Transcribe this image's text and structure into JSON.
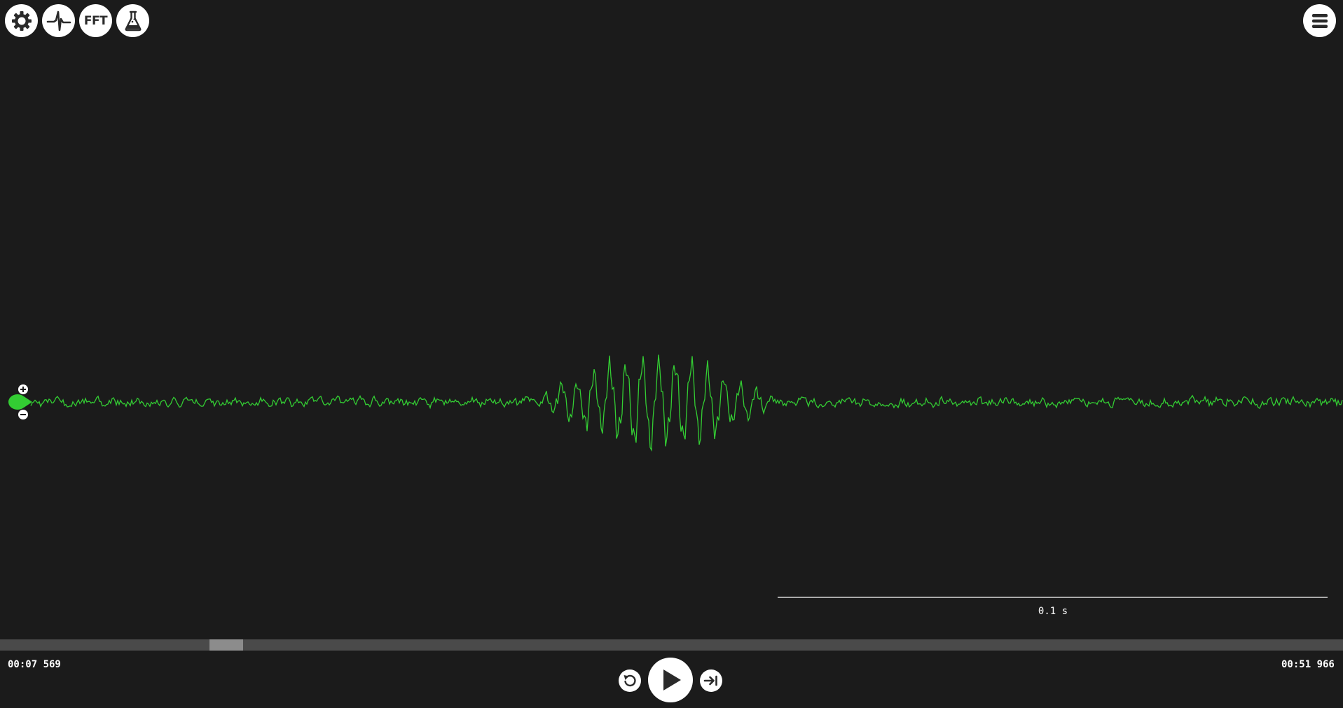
{
  "toolbar": {
    "settings_icon": "gear-icon",
    "signal_icon": "signal-pulse-icon",
    "fft_label": "FFT",
    "lab_icon": "flask-icon",
    "menu_icon": "hamburger-icon"
  },
  "channel": {
    "color": "#33cc33",
    "zoom_in_icon": "plus-icon",
    "zoom_out_icon": "minus-icon"
  },
  "timescale": {
    "label": "0.1 s"
  },
  "playback": {
    "current_time": "00:07 569",
    "total_time": "00:51 966",
    "scroll_position": 0.16,
    "rewind_icon": "rewind-icon",
    "play_icon": "play-icon",
    "skip_icon": "skip-to-end-icon"
  },
  "colors": {
    "background": "#1b1b1b",
    "trace": "#33cc33",
    "buttons": "#ffffff"
  }
}
